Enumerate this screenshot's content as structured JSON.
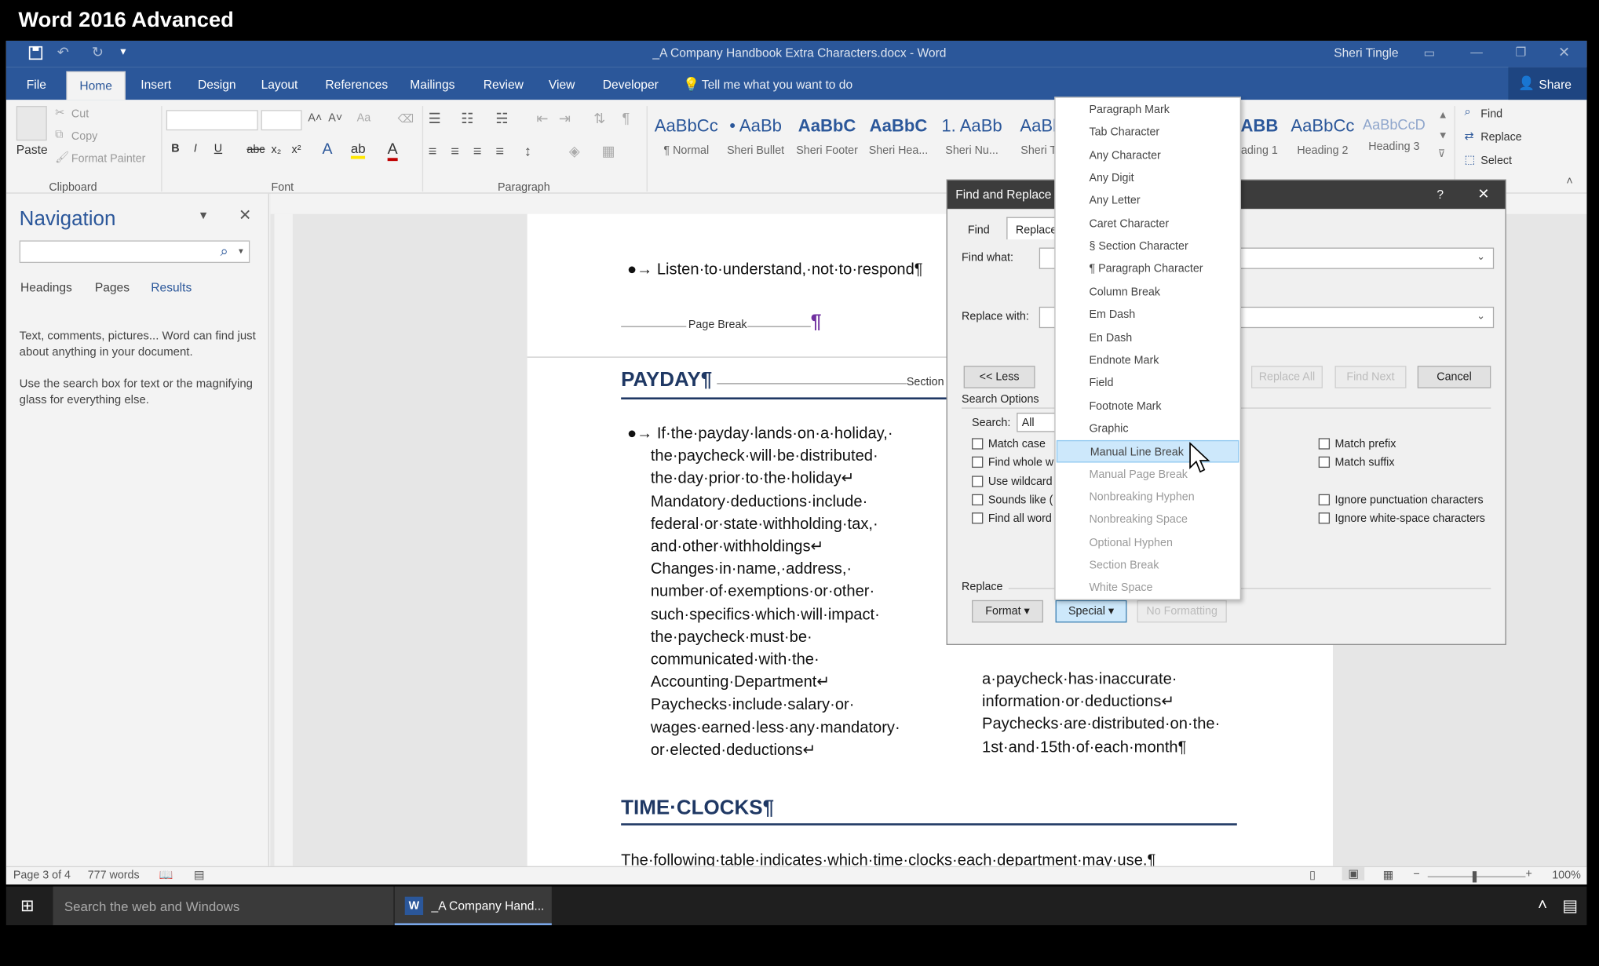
{
  "course_title": "Word 2016 Advanced",
  "window": {
    "doc_title": "_A Company Handbook Extra Characters.docx - Word",
    "user": "Sheri Tingle"
  },
  "tabs": [
    "File",
    "Home",
    "Insert",
    "Design",
    "Layout",
    "References",
    "Mailings",
    "Review",
    "View",
    "Developer"
  ],
  "tell_me": "Tell me what you want to do",
  "share": "Share",
  "clipboard": {
    "paste": "Paste",
    "cut": "Cut",
    "copy": "Copy",
    "format_painter": "Format Painter",
    "group": "Clipboard"
  },
  "font_group": "Font",
  "paragraph_group": "Paragraph",
  "styles": [
    {
      "sample": "AaBbCc",
      "name": "¶ Normal"
    },
    {
      "sample": "• AaBb",
      "name": "Sheri Bullet"
    },
    {
      "sample": "AaBbC",
      "name": "Sheri Footer"
    },
    {
      "sample": "AaBbC",
      "name": "Sheri Hea..."
    },
    {
      "sample": "1. AaBb",
      "name": "Sheri Nu..."
    },
    {
      "sample": "AaBb",
      "name": "Sheri Ta"
    },
    {
      "sample": "ABB",
      "name": "ading 1"
    },
    {
      "sample": "AaBbCc",
      "name": "Heading 2"
    },
    {
      "sample": "AaBbCcD",
      "name": "Heading 3"
    }
  ],
  "editing": {
    "find": "Find",
    "replace": "Replace",
    "select": "Select"
  },
  "navigation": {
    "title": "Navigation",
    "tabs": [
      "Headings",
      "Pages",
      "Results"
    ],
    "hint1": "Text, comments, pictures... Word can find just about anything in your document.",
    "hint2": "Use the search box for text or the magnifying glass for everything else."
  },
  "document": {
    "bullet1": "●→ Listen·to·understand,·not·to·respond¶",
    "page_break": "Page Break",
    "pilcrow": "¶",
    "heading_payday": "PAYDAY¶",
    "section_break": "Section",
    "left_col": [
      "●→ If·the·payday·lands·on·a·holiday,·",
      "the·paycheck·will·be·distributed·",
      "the·day·prior·to·the·holiday↵",
      "Mandatory·deductions·include·",
      "federal·or·state·withholding·tax,·",
      "and·other·withholdings↵",
      "Changes·in·name,·address,·",
      "number·of·exemptions·or·other·",
      "such·specifics·which·will·impact·",
      "the·paycheck·must·be·",
      "communicated·with·the·",
      "Accounting·Department↵",
      "Paychecks·include·salary·or·",
      "wages·earned·less·any·mandatory·",
      "or·elected·deductions↵"
    ],
    "right_col": [
      "a·paycheck·has·inaccurate·",
      "information·or·deductions↵",
      "Paychecks·are·distributed·on·the·",
      "1st·and·15th·of·each·month¶"
    ],
    "heading_time": "TIME·CLOCKS¶",
    "body_time": "The·following·table·indicates·which·time·clocks·each·department·may·use.¶"
  },
  "status": {
    "page": "Page 3 of 4",
    "words": "777 words",
    "zoom": "100%"
  },
  "taskbar": {
    "search": "Search the web and Windows",
    "app": "_A Company Hand..."
  },
  "dialog": {
    "title": "Find and Replace",
    "help": "?",
    "tab_find": "Find",
    "tab_replace": "Replace",
    "find_label": "Find what:",
    "replace_label": "Replace with:",
    "less_btn": "<< Less",
    "replace_all": "Replace All",
    "find_next": "Find Next",
    "cancel": "Cancel",
    "search_options": "Search Options",
    "search_label": "Search:",
    "search_value": "All",
    "left_checks": [
      "Match case",
      "Find whole w",
      "Use wildcard",
      "Sounds like (",
      "Find all word"
    ],
    "right_checks": [
      "Match prefix",
      "Match suffix",
      "Ignore punctuation characters",
      "Ignore white-space characters"
    ],
    "replace_section": "Replace",
    "format_btn": "Format ▾",
    "special_btn": "Special ▾",
    "no_formatting": "No Formatting"
  },
  "special_menu": {
    "items": [
      "Paragraph Mark",
      "Tab Character",
      "Any Character",
      "Any Digit",
      "Any Letter",
      "Caret Character",
      "§ Section Character",
      "¶ Paragraph Character",
      "Column Break",
      "Em Dash",
      "En Dash",
      "Endnote Mark",
      "Field",
      "Footnote Mark",
      "Graphic",
      "Manual Line Break",
      "Manual Page Break",
      "Nonbreaking Hyphen",
      "Nonbreaking Space",
      "Optional Hyphen",
      "Section Break",
      "White Space"
    ],
    "highlighted": "Manual Line Break"
  },
  "colors": {
    "word_blue": "#2b579a",
    "heading_blue": "#1f3864",
    "menu_highlight": "#cde8fb"
  }
}
